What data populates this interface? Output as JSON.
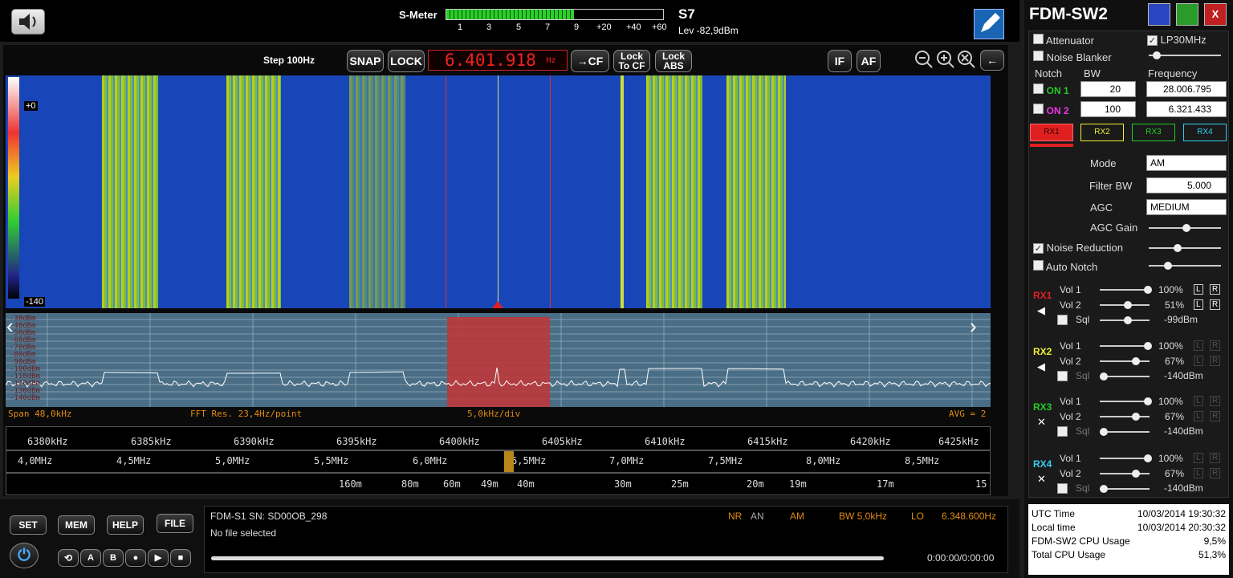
{
  "header": {
    "smeter_label": "S-Meter",
    "smeter_scale": [
      "1",
      "3",
      "5",
      "7",
      "9",
      "+20",
      "+40",
      "+60"
    ],
    "smeter_fill_fraction": 0.59,
    "s_value": "S7",
    "level": "Lev -82,9dBm"
  },
  "controls": {
    "step": "Step 100Hz",
    "snap": "SNAP",
    "lock": "LOCK",
    "frequency": "6.401.918",
    "freq_unit": "Hz",
    "to_cf": "→CF",
    "lock_to_cf": "Lock To CF",
    "lock_abs": "Lock ABS",
    "if": "IF",
    "af": "AF"
  },
  "waterfall": {
    "top_label": "+0",
    "bottom_label": "-140"
  },
  "spectrum": {
    "db_ticks": [
      "-30dBm",
      "-40dBm",
      "-50dBm",
      "-60dBm",
      "-70dBm",
      "-80dBm",
      "-90dBm",
      "-100dBm",
      "-110dBm",
      "-120dBm",
      "-130dBm",
      "-140dBm"
    ],
    "span": "Span 48,0kHz",
    "fft": "FFT Res. 23,4Hz/point",
    "div": "5,0kHz/div",
    "avg": "AVG = 2"
  },
  "scale_khz": [
    "6380kHz",
    "6385kHz",
    "6390kHz",
    "6395kHz",
    "6400kHz",
    "6405kHz",
    "6410kHz",
    "6415kHz",
    "6420kHz",
    "6425kHz"
  ],
  "scale_mhz": [
    "4,0MHz",
    "4,5MHz",
    "5,0MHz",
    "5,5MHz",
    "6,0MHz",
    "6,5MHz",
    "7,0MHz",
    "7,5MHz",
    "8,0MHz",
    "8,5MHz"
  ],
  "scale_m": [
    "160m",
    "80m",
    "60m",
    "49m",
    "40m",
    "30m",
    "25m",
    "20m",
    "19m",
    "17m",
    "15"
  ],
  "bottom": {
    "buttons": [
      "SET",
      "MEM",
      "HELP",
      "FILE"
    ],
    "device": "FDM-S1 SN: SD00OB_298",
    "file": "No file selected",
    "nr": "NR",
    "an": "AN",
    "mode": "AM",
    "bw": "BW 5,0kHz",
    "lo_label": "LO",
    "lo": "6.348.600Hz",
    "time": "0:00:00/0:00:00"
  },
  "right": {
    "title": "FDM-SW2",
    "attenuator": "Attenuator",
    "lp30": "LP30MHz",
    "noise_blanker": "Noise Blanker",
    "notch": "Notch",
    "bw": "BW",
    "frequency": "Frequency",
    "on1": "ON 1",
    "on2": "ON 2",
    "bw1": "20",
    "bw2": "100",
    "f1": "28.006.795",
    "f2": "6.321.433",
    "rx_tabs": [
      "RX1",
      "RX2",
      "RX3",
      "RX4"
    ],
    "mode_label": "Mode",
    "mode": "AM",
    "filter_label": "Filter BW",
    "filter": "5.000",
    "agc_label": "AGC",
    "agc": "MEDIUM",
    "agc_gain": "AGC Gain",
    "noise_reduction": "Noise Reduction",
    "auto_notch": "Auto Notch",
    "rx": [
      {
        "name": "RX1",
        "vol1": "Vol 1",
        "v1": "100%",
        "vol2": "Vol 2",
        "v2": "51%",
        "sql": "Sql",
        "sqv": "-99dBm"
      },
      {
        "name": "RX2",
        "vol1": "Vol 1",
        "v1": "100%",
        "vol2": "Vol 2",
        "v2": "67%",
        "sql": "Sql",
        "sqv": "-140dBm"
      },
      {
        "name": "RX3",
        "vol1": "Vol 1",
        "v1": "100%",
        "vol2": "Vol 2",
        "v2": "67%",
        "sql": "Sql",
        "sqv": "-140dBm"
      },
      {
        "name": "RX4",
        "vol1": "Vol 1",
        "v1": "100%",
        "vol2": "Vol 2",
        "v2": "67%",
        "sql": "Sql",
        "sqv": "-140dBm"
      }
    ],
    "lr": [
      "L",
      "R"
    ]
  },
  "status": {
    "utc_label": "UTC Time",
    "utc": "10/03/2014 19:30:32",
    "local_label": "Local time",
    "local": "10/03/2014 20:30:32",
    "cpu_label": "FDM-SW2 CPU Usage",
    "cpu": "9,5%",
    "total_label": "Total CPU Usage",
    "total": "51,3%"
  }
}
